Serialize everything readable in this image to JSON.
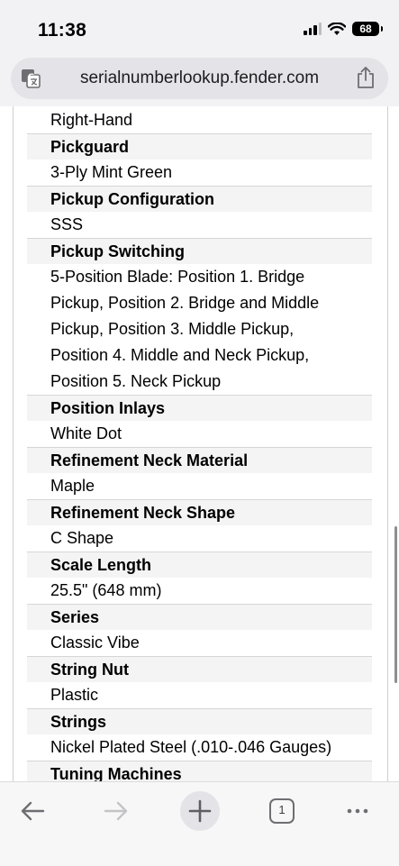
{
  "status_bar": {
    "time": "11:38",
    "battery": "68"
  },
  "address_bar": {
    "url": "serialnumberlookup.fender.com"
  },
  "specs": {
    "top_value": "Right-Hand",
    "items": [
      {
        "label": "Pickguard",
        "value": "3-Ply Mint Green"
      },
      {
        "label": "Pickup Configuration",
        "value": "SSS"
      },
      {
        "label": "Pickup Switching",
        "value_lines": [
          "5-Position Blade: Position 1. Bridge",
          "Pickup, Position 2. Bridge and Middle",
          "Pickup, Position 3. Middle Pickup,",
          "Position 4. Middle and Neck Pickup,",
          "Position 5. Neck Pickup"
        ]
      },
      {
        "label": "Position Inlays",
        "value": "White Dot"
      },
      {
        "label": "Refinement Neck Material",
        "value": "Maple"
      },
      {
        "label": "Refinement Neck Shape",
        "value": "C Shape"
      },
      {
        "label": "Scale Length",
        "value": "25.5\" (648 mm)"
      },
      {
        "label": "Series",
        "value": "Classic Vibe"
      },
      {
        "label": "String Nut",
        "value": "Plastic"
      },
      {
        "label": "Strings",
        "value": "Nickel Plated Steel (.010-.046 Gauges)"
      },
      {
        "label": "Tuning Machines"
      }
    ]
  },
  "bottom_bar": {
    "tab_count": "1"
  },
  "icons": {
    "translate": "translate-icon",
    "share": "share-icon",
    "back": "back-arrow-icon",
    "forward": "forward-arrow-icon",
    "new_tab": "plus-icon",
    "tabs": "tabs-icon",
    "more": "more-icon"
  }
}
